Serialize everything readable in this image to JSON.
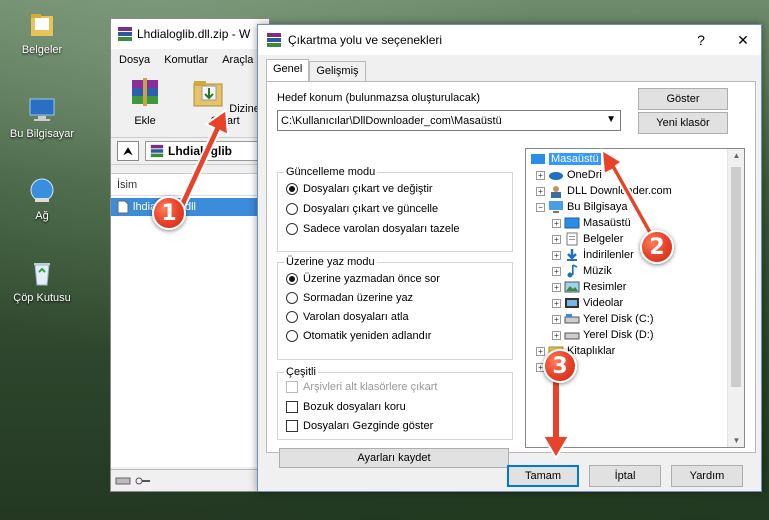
{
  "desktop": {
    "icons": [
      {
        "label": "Belgeler",
        "icon": "folder-icon"
      },
      {
        "label": "Bu Bilgisayar",
        "icon": "computer-icon"
      },
      {
        "label": "Ağ",
        "icon": "network-icon"
      },
      {
        "label": "Çöp Kutusu",
        "icon": "recycle-bin-icon"
      }
    ]
  },
  "winrar": {
    "title": "Lhdialoglib.dll.zip - W",
    "menu": [
      "Dosya",
      "Komutlar",
      "Araçla"
    ],
    "toolbar": {
      "add": "Ekle",
      "extract": "Dizine Çıkart"
    },
    "path": "Lhdialoglib",
    "column": "İsim",
    "file": "lhdialoglib.dll"
  },
  "dialog": {
    "title": "Çıkartma yolu ve seçenekleri",
    "help": "?",
    "close": "✕",
    "tabs": [
      "Genel",
      "Gelişmiş"
    ],
    "dest_label": "Hedef konum (bulunmazsa oluşturulacak)",
    "dest_value": "C:\\Kullanıcılar\\DllDownloader_com\\Masaüstü",
    "btn_show": "Göster",
    "btn_newfolder": "Yeni klasör",
    "update_group": {
      "title": "Güncelleme modu",
      "options": [
        "Dosyaları çıkart ve değiştir",
        "Dosyaları çıkart ve güncelle",
        "Sadece varolan dosyaları tazele"
      ],
      "selected": 0
    },
    "overwrite_group": {
      "title": "Üzerine yaz modu",
      "options": [
        "Üzerine yazmadan önce sor",
        "Sormadan üzerine yaz",
        "Varolan dosyaları atla",
        "Otomatik yeniden adlandır"
      ],
      "selected": 0
    },
    "misc_group": {
      "title": "Çeşitli",
      "options": [
        "Arşivleri alt klasörlere çıkart",
        "Bozuk dosyaları koru",
        "Dosyaları Gezginde göster"
      ]
    },
    "btn_save": "Ayarları kaydet",
    "tree": [
      "Masaüstü",
      "OneDri",
      "DLL Downloader.com",
      "Bu Bilgisaya",
      "Masaüstü",
      "Belgeler",
      "İndirilenler",
      "Müzik",
      "Resimler",
      "Videolar",
      "Yerel Disk (C:)",
      "Yerel Disk (D:)",
      "Kitaplıklar"
    ],
    "btn_ok": "Tamam",
    "btn_cancel": "İptal",
    "btn_help": "Yardım"
  },
  "annotations": [
    "1",
    "2",
    "3"
  ],
  "colors": {
    "accent": "#0078d7",
    "marker": "#e8432a",
    "selection": "#3399ff"
  }
}
